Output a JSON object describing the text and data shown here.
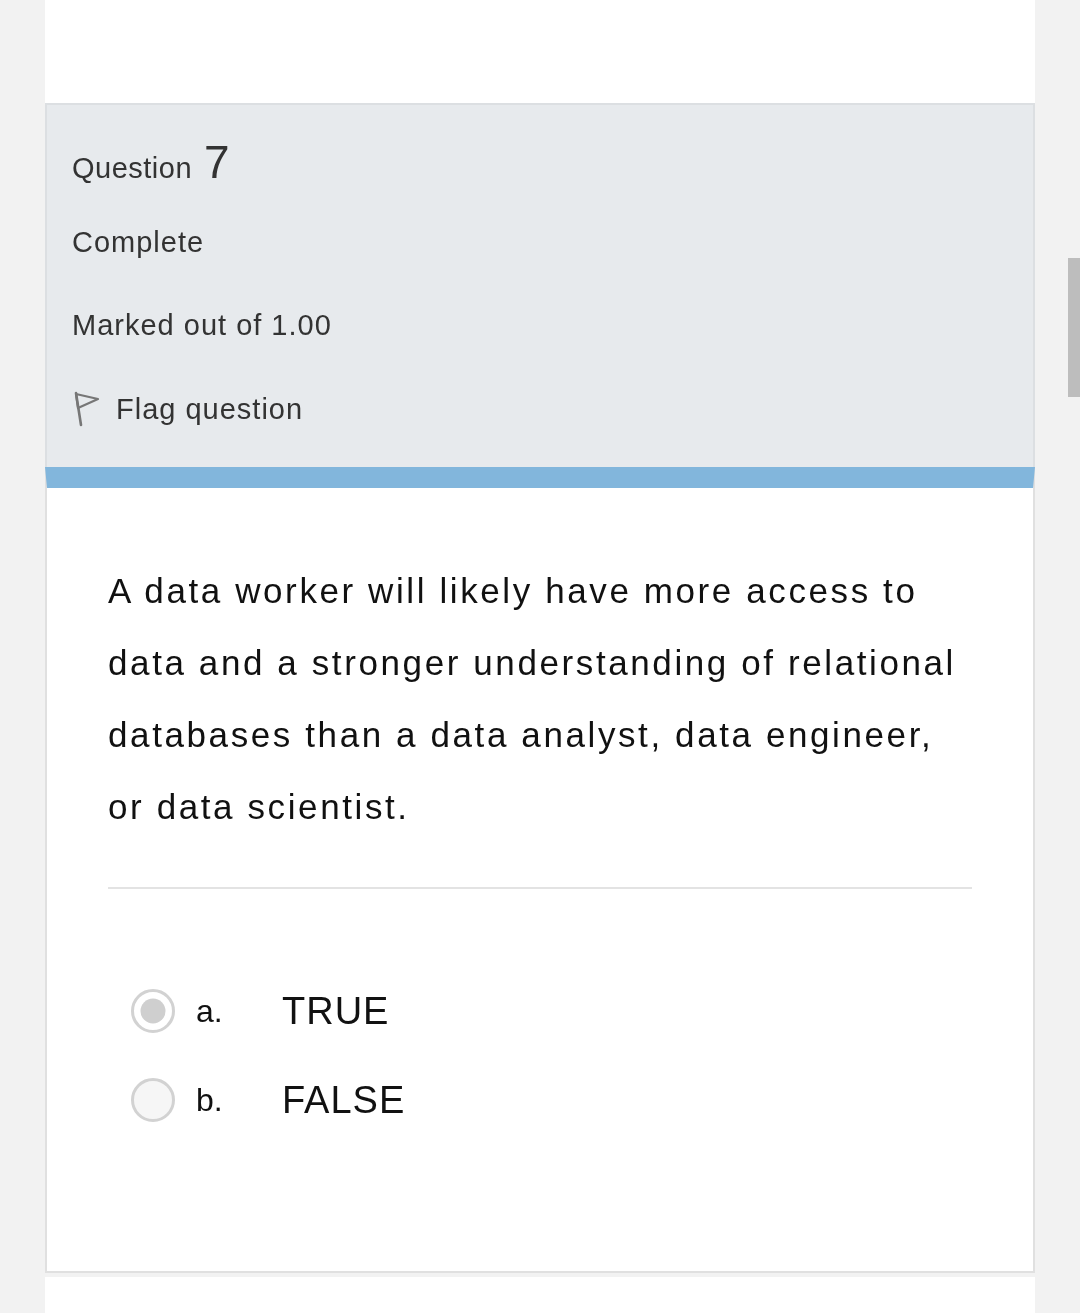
{
  "question": {
    "label": "Question",
    "number": "7",
    "state": "Complete",
    "grade": "Marked out of 1.00",
    "flag": {
      "label": "Flag question",
      "flagged": false
    }
  },
  "prompt": {
    "text": "A data worker will likely have more access to data and a stronger understanding of relational databases than a data analyst, data engineer, or data scientist."
  },
  "answers": [
    {
      "letter": "a.",
      "text": "TRUE",
      "selected": true
    },
    {
      "letter": "b.",
      "text": "FALSE",
      "selected": false
    }
  ]
}
